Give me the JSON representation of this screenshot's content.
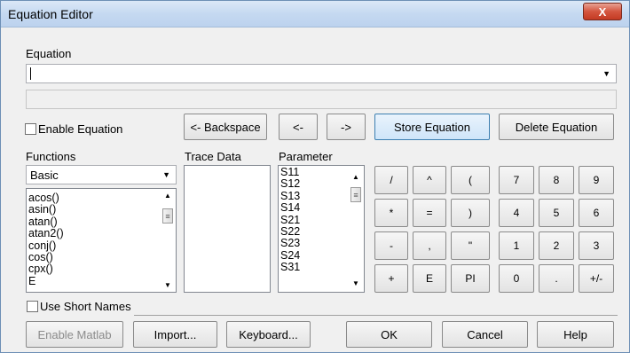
{
  "window": {
    "title": "Equation Editor",
    "close_glyph": "X"
  },
  "equation": {
    "label": "Equation",
    "value": "",
    "status": ""
  },
  "enable_equation": {
    "label": "Enable Equation",
    "checked": false
  },
  "nav": {
    "backspace": "<- Backspace",
    "left": "<-",
    "right": "->"
  },
  "actions": {
    "store": "Store Equation",
    "delete": "Delete Equation"
  },
  "functions": {
    "label": "Functions",
    "category": "Basic",
    "items": [
      "acos()",
      "asin()",
      "atan()",
      "atan2()",
      "conj()",
      "cos()",
      "cpx()",
      "E"
    ]
  },
  "trace": {
    "label": "Trace Data",
    "items": []
  },
  "parameter": {
    "label": "Parameter",
    "items": [
      "S11",
      "S12",
      "S13",
      "S14",
      "S21",
      "S22",
      "S23",
      "S24",
      "S31"
    ]
  },
  "ops": [
    "/",
    "^",
    "(",
    "*",
    "=",
    ")",
    "-",
    ",",
    "\"",
    "+",
    "E",
    "PI"
  ],
  "digits": [
    "7",
    "8",
    "9",
    "4",
    "5",
    "6",
    "1",
    "2",
    "3",
    "0",
    ".",
    "+/-"
  ],
  "short_names": {
    "label": "Use Short Names",
    "checked": false
  },
  "footer": {
    "enable_matlab": "Enable Matlab",
    "import": "Import...",
    "keyboard": "Keyboard...",
    "ok": "OK",
    "cancel": "Cancel",
    "help": "Help"
  }
}
